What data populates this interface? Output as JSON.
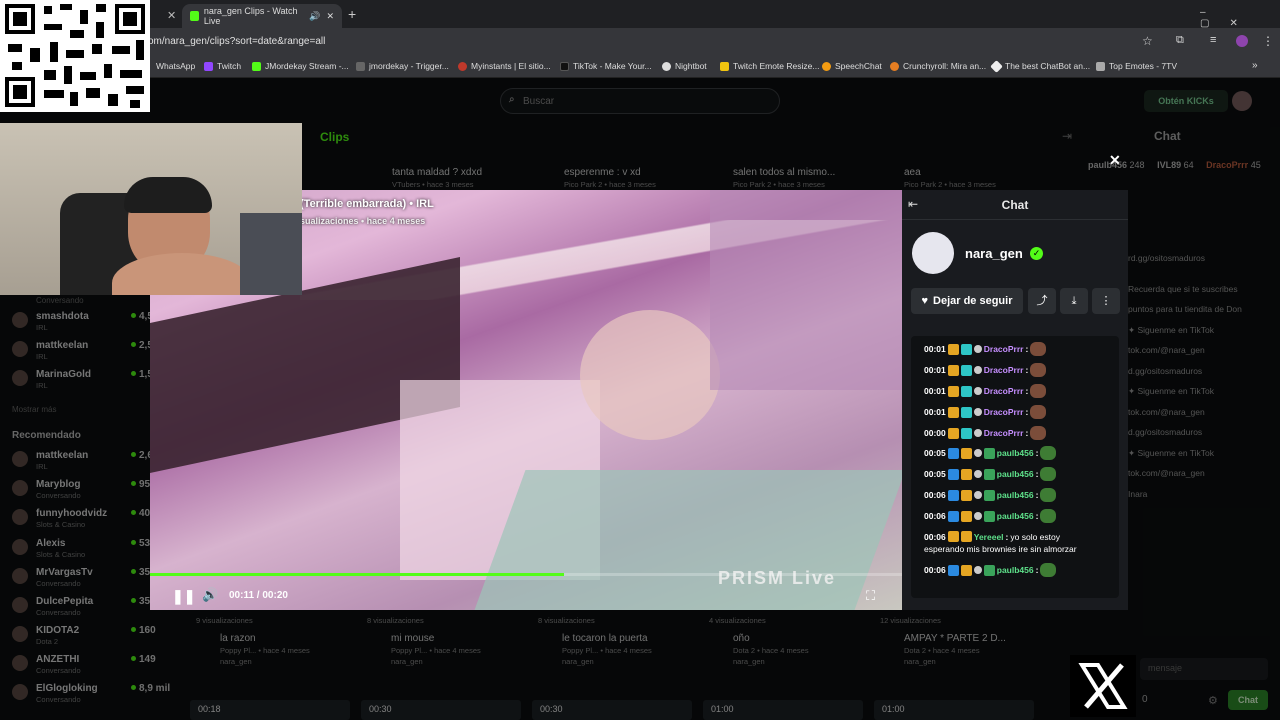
{
  "browser": {
    "tabs": [
      {
        "title": "nara_gen Clips - Watch Live"
      }
    ],
    "url": "om/nara_gen/clips?sort=date&range=all",
    "bookmarks": [
      "WhatsApp",
      "Twitch",
      "JMordekay Stream -...",
      "jmordekay - Trigger...",
      "Myinstants | El sitio...",
      "TikTok - Make Your...",
      "Nightbot",
      "Twitch Emote Resize...",
      "SpeechChat",
      "Crunchyroll: Mira an...",
      "The best ChatBot an...",
      "Top Emotes - 7TV"
    ]
  },
  "page": {
    "search_placeholder": "Buscar",
    "kicks_button": "Obtén KICKs",
    "clips_tab": "Clips",
    "chat_title": "Chat",
    "sidebar": {
      "following": [
        {
          "name": "smashdota",
          "sub": "IRL",
          "count": "4,5 m"
        },
        {
          "name": "mattkeelan",
          "sub": "IRL",
          "count": "2,5 m"
        },
        {
          "name": "MarinaGold",
          "sub": "IRL",
          "count": "1,5 m"
        }
      ],
      "conversando": "Conversando",
      "show_more": "Mostrar más",
      "recommended_title": "Recomendado",
      "recommended": [
        {
          "name": "mattkeelan",
          "sub": "IRL",
          "count": "2,6 m"
        },
        {
          "name": "Maryblog",
          "sub": "Conversando",
          "count": "95"
        },
        {
          "name": "funnyhoodvidz",
          "sub": "Slots & Casino",
          "count": "40"
        },
        {
          "name": "Alexis",
          "sub": "Slots & Casino",
          "count": "53"
        },
        {
          "name": "MrVargasTv",
          "sub": "Conversando",
          "count": "35"
        },
        {
          "name": "DulcePepita",
          "sub": "Conversando",
          "count": "35"
        },
        {
          "name": "KIDOTA2",
          "sub": "Dota 2",
          "count": "160"
        },
        {
          "name": "ANZETHI",
          "sub": "Conversando",
          "count": "149"
        },
        {
          "name": "ElGlogloking",
          "sub": "Conversando",
          "count": "8,9 mil"
        }
      ]
    },
    "clips_top": [
      {
        "title": "tanta maldad ? xdxd",
        "meta": "VTubers • hace 3 meses"
      },
      {
        "title": "esperenme : v xd",
        "meta": "Pico Park 2 • hace 3 meses"
      },
      {
        "title": "salen todos al mismo...",
        "meta": "Pico Park 2 • hace 3 meses"
      },
      {
        "title": "aea",
        "meta": "Pico Park 2 • hace 3 meses"
      }
    ],
    "clips_bottom": [
      {
        "views": "9 visualizaciones",
        "title": "la razon",
        "meta": "Poppy Pl... • hace 4 meses",
        "author": "nara_gen"
      },
      {
        "views": "8 visualizaciones",
        "title": "mi mouse",
        "meta": "Poppy Pl... • hace 4 meses",
        "author": "nara_gen"
      },
      {
        "views": "8 visualizaciones",
        "title": "le tocaron la puerta",
        "meta": "Poppy Pl... • hace 4 meses",
        "author": "nara_gen"
      },
      {
        "views": "4 visualizaciones",
        "title": "oño",
        "meta": "Dota 2 • hace 4 meses",
        "author": "nara_gen"
      },
      {
        "views": "12 visualizaciones",
        "title": "AMPAY * PARTE 2 D...",
        "meta": "Dota 2 • hace 4 meses",
        "author": "nara_gen"
      }
    ],
    "bottom_durations": [
      "00:18",
      "00:30",
      "00:30",
      "01:00",
      "01:00"
    ],
    "side_chat": {
      "top_users": [
        {
          "name": "paulb456",
          "v": "248"
        },
        {
          "name": "IVL89",
          "v": "64"
        },
        {
          "name": "DracoPrrr",
          "v": "45"
        }
      ],
      "lines": [
        "rd.gg/ositosmaduros",
        "Recuerda que si te suscribes",
        "puntos para tu tiendita de Don",
        "✦ Siguenme en TikTok",
        "tok.com/@nara_gen",
        "d.gg/ositosmaduros",
        "✦ Siguenme en TikTok",
        "tok.com/@nara_gen",
        "d.gg/ositosmaduros",
        "✦ Siguenme en TikTok",
        "tok.com/@nara_gen",
        "Inara"
      ],
      "message_placeholder": "mensaje",
      "chat_button": "Chat",
      "count": "0"
    }
  },
  "modal": {
    "clip_title": "(Terrible embarrada) • IRL",
    "clip_meta": "sualizaciones • hace 4 meses",
    "time": "00:11 / 00:20",
    "progress": 0.55,
    "watermark": "PRISM Live",
    "chat_title": "Chat",
    "channel": "nara_gen",
    "unfollow": "Dejar de seguir",
    "messages": [
      {
        "t": "00:01",
        "user": "DracoPrrr",
        "text": "",
        "color": "pu"
      },
      {
        "t": "00:01",
        "user": "DracoPrrr",
        "text": "",
        "color": "pu"
      },
      {
        "t": "00:01",
        "user": "DracoPrrr",
        "text": "",
        "color": "pu"
      },
      {
        "t": "00:01",
        "user": "DracoPrrr",
        "text": "",
        "color": "pu"
      },
      {
        "t": "00:00",
        "user": "DracoPrrr",
        "text": "",
        "color": "pu"
      },
      {
        "t": "00:05",
        "user": "paulb456",
        "text": "",
        "color": "gr"
      },
      {
        "t": "00:05",
        "user": "paulb456",
        "text": "",
        "color": "gr"
      },
      {
        "t": "00:06",
        "user": "paulb456",
        "text": "",
        "color": "gr"
      },
      {
        "t": "00:06",
        "user": "paulb456",
        "text": "",
        "color": "gr"
      },
      {
        "t": "00:06",
        "user": "Yereeel",
        "text": "yo solo estoy",
        "text2": "esperando mis brownies ire sin almorzar",
        "color": "gr"
      },
      {
        "t": "00:06",
        "user": "paulb456",
        "text": "",
        "color": "gr"
      }
    ]
  },
  "colors": {
    "accent": "#53fc18",
    "bg": "#0b0e0f",
    "chat_bg": "#191b1f"
  }
}
